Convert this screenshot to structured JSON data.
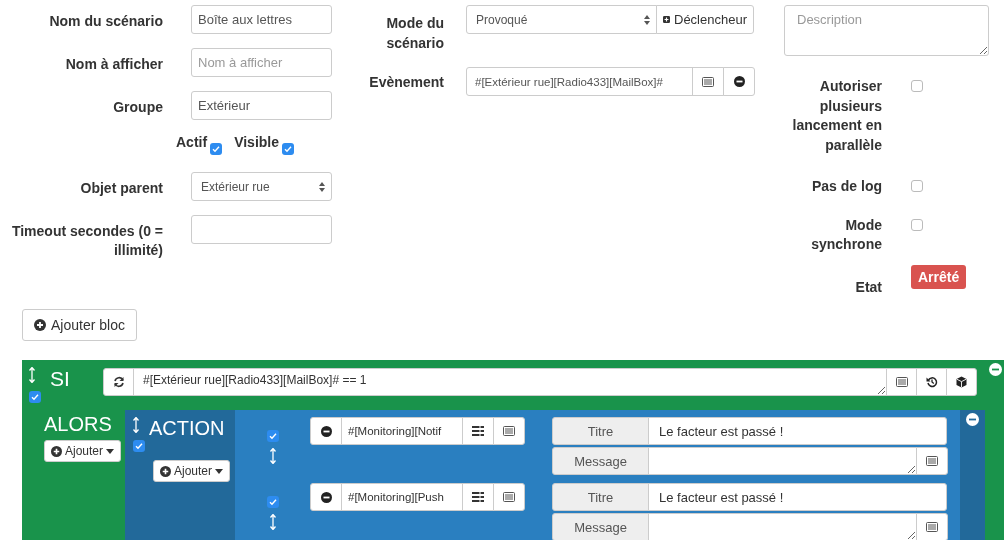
{
  "general": {
    "fields": [
      {
        "kind": "text",
        "label": "Nom du scénario",
        "value": "Boîte aux lettres"
      },
      {
        "kind": "text",
        "label": "Nom à afficher",
        "placeholder": "Nom à afficher"
      },
      {
        "kind": "text",
        "label": "Groupe",
        "value": "Extérieur"
      },
      {
        "kind": "flags",
        "flags": [
          {
            "label": "Actif",
            "checked": true
          },
          {
            "label": "Visible",
            "checked": true
          }
        ]
      },
      {
        "kind": "select",
        "label": "Objet parent",
        "value": "Extérieur rue"
      },
      {
        "kind": "text",
        "label": "Timeout secondes (0 = illimité)"
      }
    ]
  },
  "trigger": {
    "mode_label": "Mode du scénario",
    "mode_value": "Provoqué",
    "trigger_button": "Déclencheur",
    "event_label": "Evènement",
    "event_value": "#[Extérieur rue][Radio433][MailBox]#"
  },
  "settings": {
    "description_placeholder": "Description",
    "options": [
      {
        "label": "Autoriser plusieurs lancement en parallèle",
        "checked": false
      },
      {
        "label": "Pas de log",
        "checked": false
      },
      {
        "label": "Mode synchrone",
        "checked": false
      }
    ],
    "state_label": "Etat",
    "state_value": "Arrêté"
  },
  "add_block_button": "Ajouter bloc",
  "block": {
    "keyword": "SI",
    "enabled": true,
    "condition": "#[Extérieur rue][Radio433][MailBox]# == 1",
    "then_label": "ALORS",
    "add_button": "Ajouter",
    "action_block": {
      "keyword": "ACTION",
      "enabled": true,
      "add_button": "Ajouter",
      "actions": [
        {
          "enabled": true,
          "command": "#[Monitoring][Notif",
          "options": [
            {
              "label": "Titre",
              "value": "Le facteur est passé !"
            },
            {
              "label": "Message"
            }
          ]
        },
        {
          "enabled": true,
          "command": "#[Monitoring][Push",
          "options": [
            {
              "label": "Titre",
              "value": "Le facteur est passé !"
            },
            {
              "label": "Message"
            }
          ]
        }
      ]
    }
  }
}
